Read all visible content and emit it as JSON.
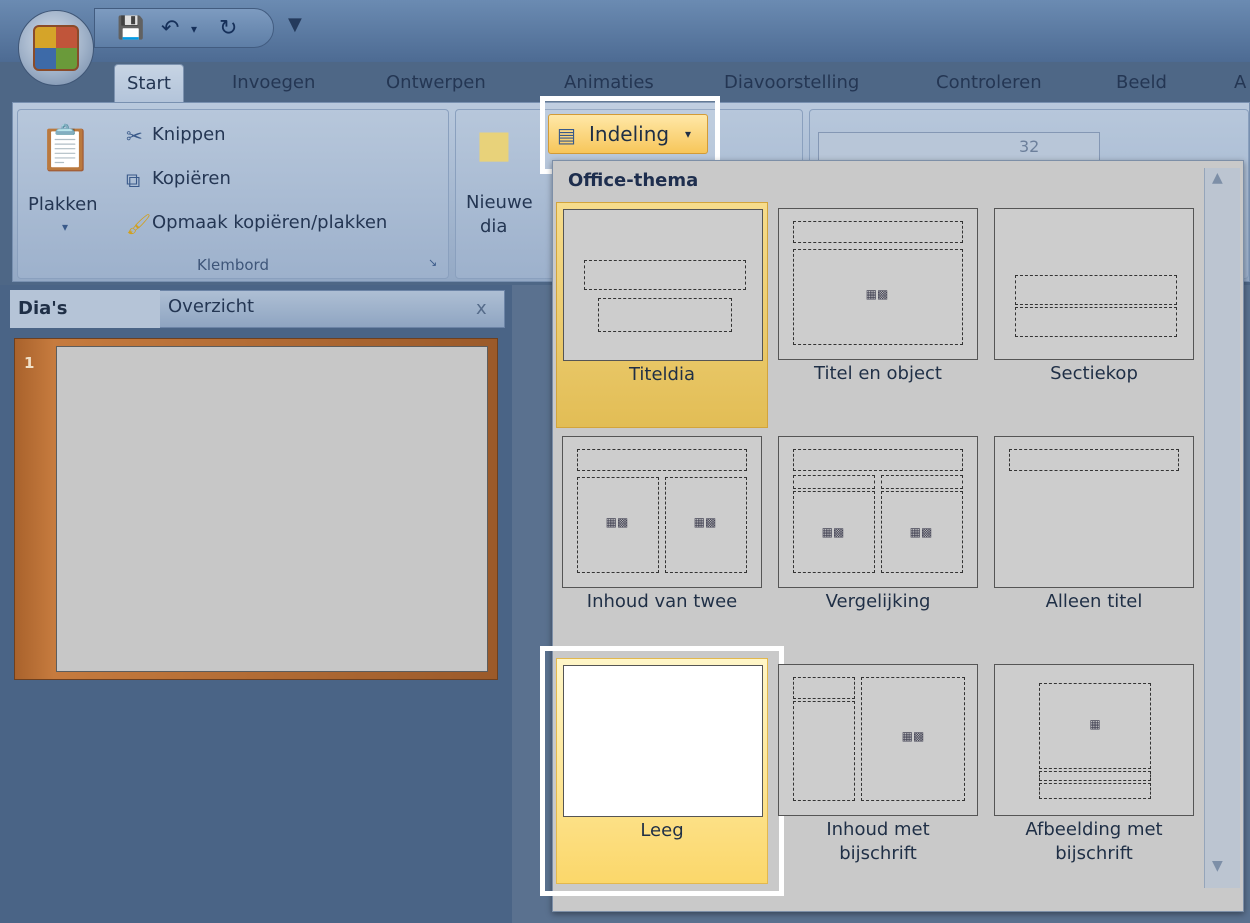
{
  "tabs": [
    "Start",
    "Invoegen",
    "Ontwerpen",
    "Animaties",
    "Diavoorstelling",
    "Controleren",
    "Beeld",
    "A"
  ],
  "clipboard": {
    "paste_label": "Plakken",
    "cut_label": "Knippen",
    "copy_label": "Kopiëren",
    "format_painter_label": "Opmaak kopiëren/plakken",
    "group_label": "Klembord"
  },
  "slides_group": {
    "new_slide_label_line1": "Nieuwe",
    "new_slide_label_line2": "dia",
    "layout_button_label": "Indeling"
  },
  "font": {
    "size_value": "32"
  },
  "left_pane": {
    "tab_slides": "Dia's",
    "tab_outline": "Overzicht",
    "close_glyph": "x",
    "slide_number": "1"
  },
  "layout_gallery": {
    "header": "Office-thema",
    "items": [
      {
        "label": "Titeldia"
      },
      {
        "label": "Titel en object"
      },
      {
        "label": "Sectiekop"
      },
      {
        "label": "Inhoud van twee"
      },
      {
        "label": "Vergelijking"
      },
      {
        "label": "Alleen titel"
      },
      {
        "label": "Leeg"
      },
      {
        "label_line1": "Inhoud met",
        "label_line2": "bijschrift"
      },
      {
        "label_line1": "Afbeelding met",
        "label_line2": "bijschrift"
      }
    ]
  },
  "colors": {
    "highlight": "#ffffff",
    "selected_gold": "#f6dc8c",
    "ribbon_blue": "#b9c9dd"
  }
}
